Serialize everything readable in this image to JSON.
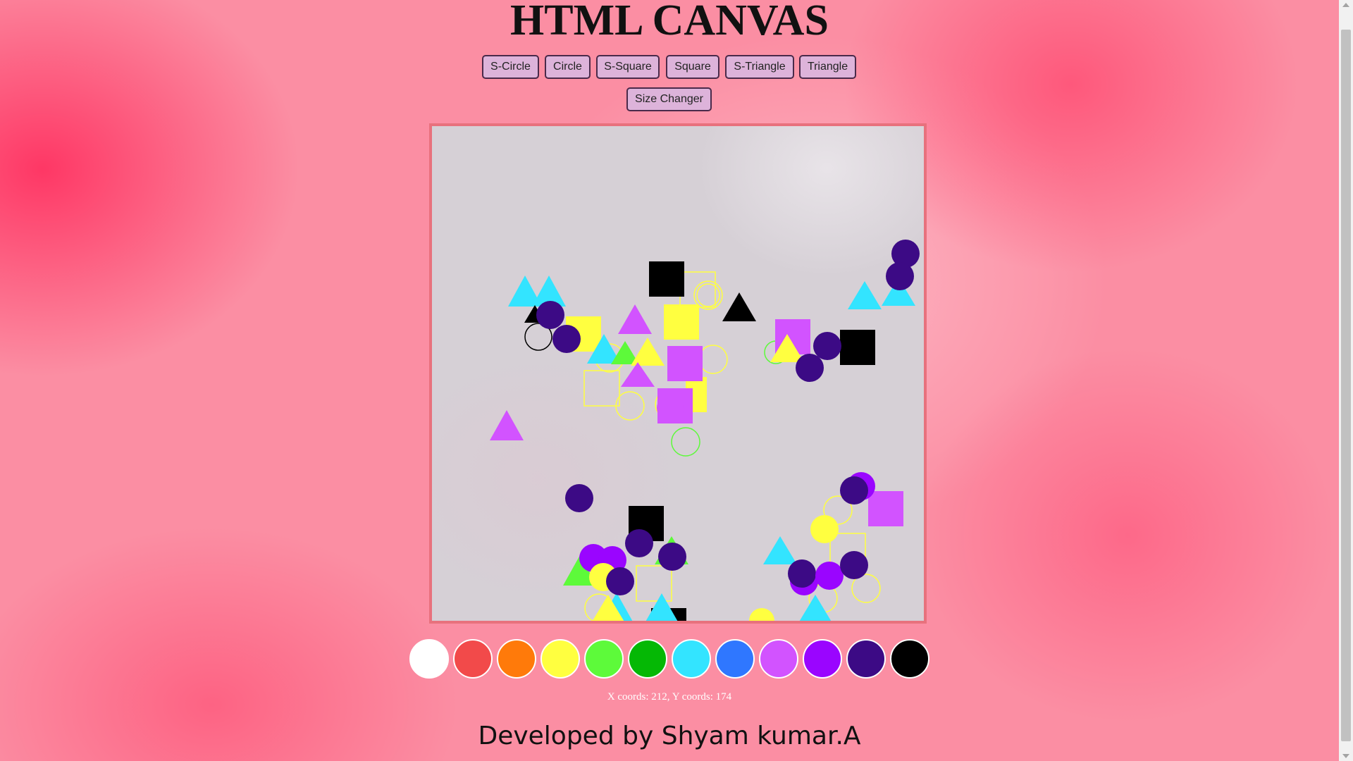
{
  "page": {
    "title": "HTML CANVAS"
  },
  "toolbar": {
    "buttons": [
      "S-Circle",
      "Circle",
      "S-Square",
      "Square",
      "S-Triangle",
      "Triangle"
    ],
    "size_changer": "Size Changer"
  },
  "palette": {
    "colors": [
      "#ffffff",
      "#f24a4a",
      "#ff7a0a",
      "#ffff40",
      "#5dfa3a",
      "#05b805",
      "#33e4ff",
      "#2f77ff",
      "#d253ff",
      "#9a05ff",
      "#3c0a85",
      "#000000"
    ]
  },
  "status": {
    "coords": "X coords: 212, Y coords: 174"
  },
  "footer": {
    "text": "Developed by Shyam kumar.A"
  }
}
